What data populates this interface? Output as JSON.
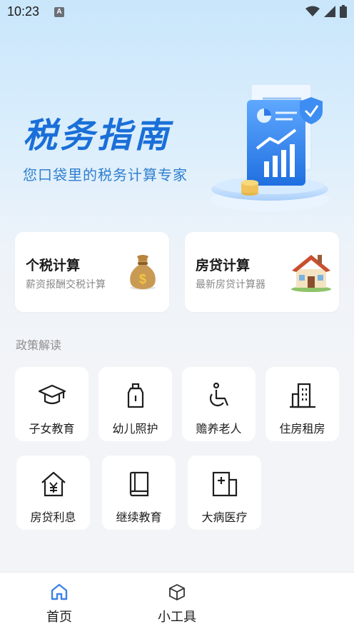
{
  "status_bar": {
    "time": "10:23",
    "indicator": "A"
  },
  "hero": {
    "title": "税务指南",
    "subtitle": "您口袋里的税务计算专家"
  },
  "feature_cards": [
    {
      "title": "个税计算",
      "desc": "薪资报酬交税计算",
      "icon": "money-bag-icon"
    },
    {
      "title": "房贷计算",
      "desc": "最新房贷计算器",
      "icon": "house-icon"
    }
  ],
  "section": {
    "label": "政策解读"
  },
  "policy_items": [
    {
      "label": "子女教育",
      "icon": "graduation-cap-icon"
    },
    {
      "label": "幼儿照护",
      "icon": "baby-bottle-icon"
    },
    {
      "label": "赡养老人",
      "icon": "wheelchair-icon"
    },
    {
      "label": "住房租房",
      "icon": "building-icon"
    },
    {
      "label": "房贷利息",
      "icon": "house-yen-icon"
    },
    {
      "label": "继续教育",
      "icon": "book-icon"
    },
    {
      "label": "大病医疗",
      "icon": "medical-icon"
    }
  ],
  "bottom_nav": [
    {
      "label": "首页",
      "icon": "home-icon",
      "active": true
    },
    {
      "label": "小工具",
      "icon": "cube-icon",
      "active": false
    }
  ],
  "colors": {
    "accent": "#1a6fd8",
    "active_nav": "#3b82e8",
    "background": "#f2f4f7"
  }
}
